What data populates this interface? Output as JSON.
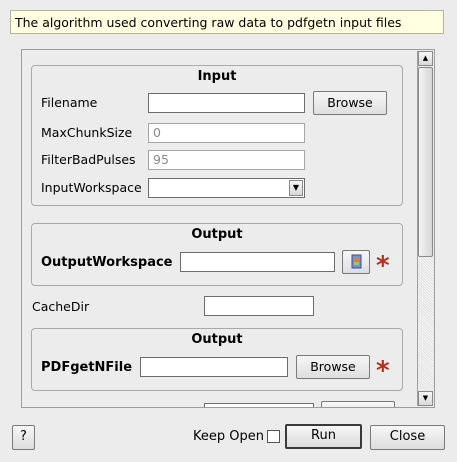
{
  "description": "The algorithm used converting raw data to pdfgetn input files",
  "input_group": {
    "title": "Input",
    "filename": {
      "label": "Filename",
      "value": "",
      "browse_label": "Browse"
    },
    "max_chunk_size": {
      "label": "MaxChunkSize",
      "value": "0"
    },
    "filter_bad_pulses": {
      "label": "FilterBadPulses",
      "value": "95"
    },
    "input_workspace": {
      "label": "InputWorkspace",
      "value": ""
    }
  },
  "output_group_1": {
    "title": "Output",
    "output_workspace": {
      "label": "OutputWorkspace",
      "value": "",
      "required": "*"
    }
  },
  "cache_dir": {
    "label": "CacheDir",
    "value": ""
  },
  "output_group_2": {
    "title": "Output",
    "pdfgetn_file": {
      "label": "PDFgetNFile",
      "value": "",
      "browse_label": "Browse",
      "required": "*"
    }
  },
  "footer": {
    "help_label": "?",
    "keep_open_label": "Keep Open",
    "keep_open_checked": false,
    "run_label": "Run",
    "close_label": "Close"
  },
  "colors": {
    "description_bg": "#ffffe1",
    "required_star": "#b5321d",
    "window_bg": "#ececec"
  }
}
